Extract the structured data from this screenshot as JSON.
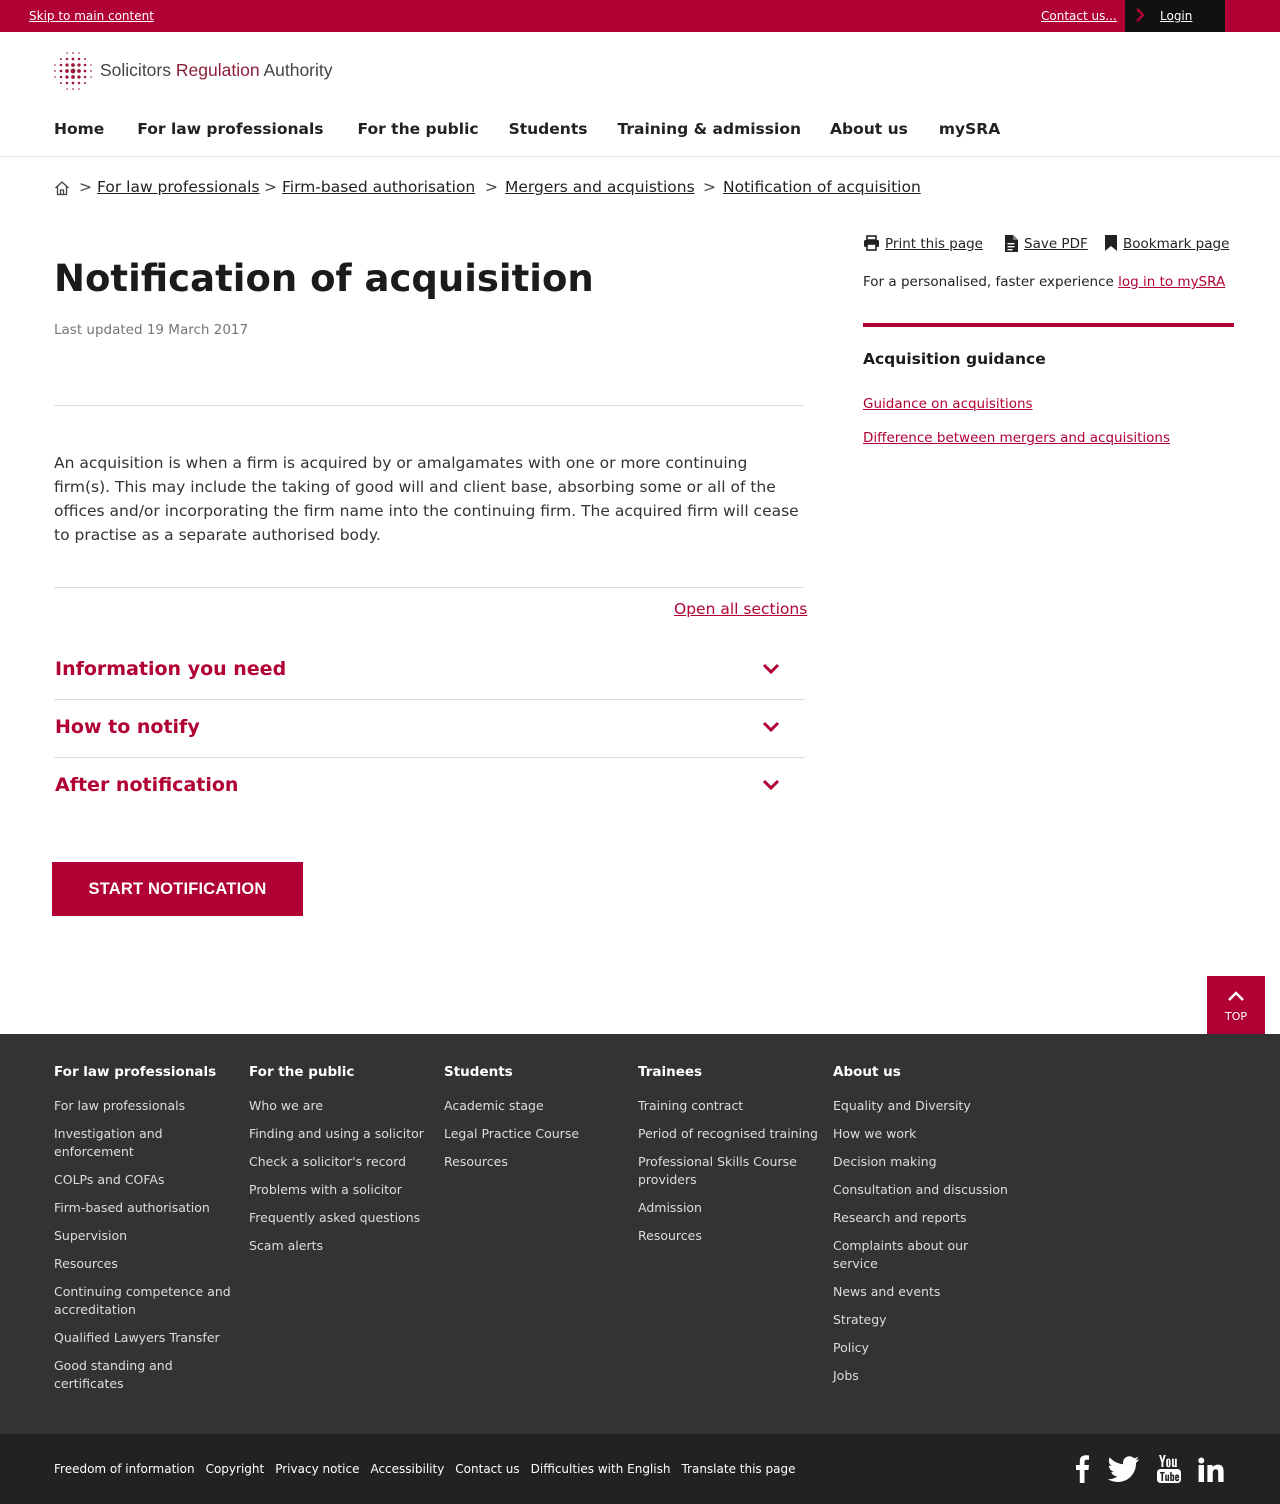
{
  "topbar": {
    "skip_link": "Skip to main content",
    "contact_link": "Contact us...",
    "login_label": "Login"
  },
  "brand": {
    "word1": "Solicitors",
    "word2": "Regulation",
    "word3": "Authority"
  },
  "nav": {
    "items": [
      "Home",
      "For law professionals",
      "For the public",
      "Students",
      "Training & admission",
      "About us",
      "mySRA"
    ]
  },
  "breadcrumb": {
    "items": [
      "For law professionals",
      "Firm-based authorisation",
      "Mergers and acquistions",
      "Notification of acquisition"
    ],
    "separator": ">"
  },
  "page": {
    "title": "Notification of acquisition",
    "updated": "Last updated 19 March 2017",
    "intro": "An acquisition is when a firm is acquired by or amalgamates with one or more continuing firm(s). This may include the taking of good will and client base, absorbing some or all of the offices and/or incorporating the firm name into the continuing firm. The acquired firm will cease to practise as a separate authorised body.",
    "open_all": "Open all sections",
    "sections": [
      "Information you need",
      "How to notify",
      "After notification"
    ],
    "start_button": "START NOTIFICATION"
  },
  "sidebar": {
    "tools": [
      "Print this page",
      "Save PDF",
      "Bookmark page"
    ],
    "personal_text": "For a personalised, faster experience",
    "personal_link": "log in to mySRA",
    "guidance_heading": "Acquisition guidance",
    "guidance_links": [
      "Guidance on acquisitions",
      "Difference between mergers and acquisitions"
    ]
  },
  "top_button": "TOP",
  "footer": {
    "columns": [
      {
        "heading": "For law professionals",
        "links": [
          "For law professionals",
          "Investigation and enforcement",
          "COLPs and COFAs",
          "Firm-based authorisation",
          "Supervision",
          "Resources",
          "Continuing competence and accreditation",
          "Qualified Lawyers Transfer",
          "Good standing and certificates"
        ]
      },
      {
        "heading": "For the public",
        "links": [
          "Who we are",
          "Finding and using a solicitor",
          "Check a solicitor's record",
          "Problems with a solicitor",
          "Frequently asked questions",
          "Scam alerts"
        ]
      },
      {
        "heading": "Students",
        "links": [
          "Academic stage",
          "Legal Practice Course",
          "Resources"
        ]
      },
      {
        "heading": "Trainees",
        "links": [
          "Training contract",
          "Period of recognised training",
          "Professional Skills Course providers",
          "Admission",
          "Resources"
        ]
      },
      {
        "heading": "About us",
        "links": [
          "Equality and Diversity",
          "How we work",
          "Decision making",
          "Consultation and discussion",
          "Research and reports",
          "Complaints about our service",
          "News and events",
          "Strategy",
          "Policy",
          "Jobs"
        ]
      }
    ],
    "bottom_links": [
      "Freedom of information",
      "Copyright",
      "Privacy notice",
      "Accessibility",
      "Contact us",
      "Difficulties with English",
      "Translate this page"
    ],
    "social": [
      "facebook-icon",
      "twitter-icon",
      "youtube-icon",
      "linkedin-icon"
    ]
  },
  "colors": {
    "brand_red": "#b10034",
    "footer_bg": "#333333",
    "bottom_bg": "#222222"
  }
}
